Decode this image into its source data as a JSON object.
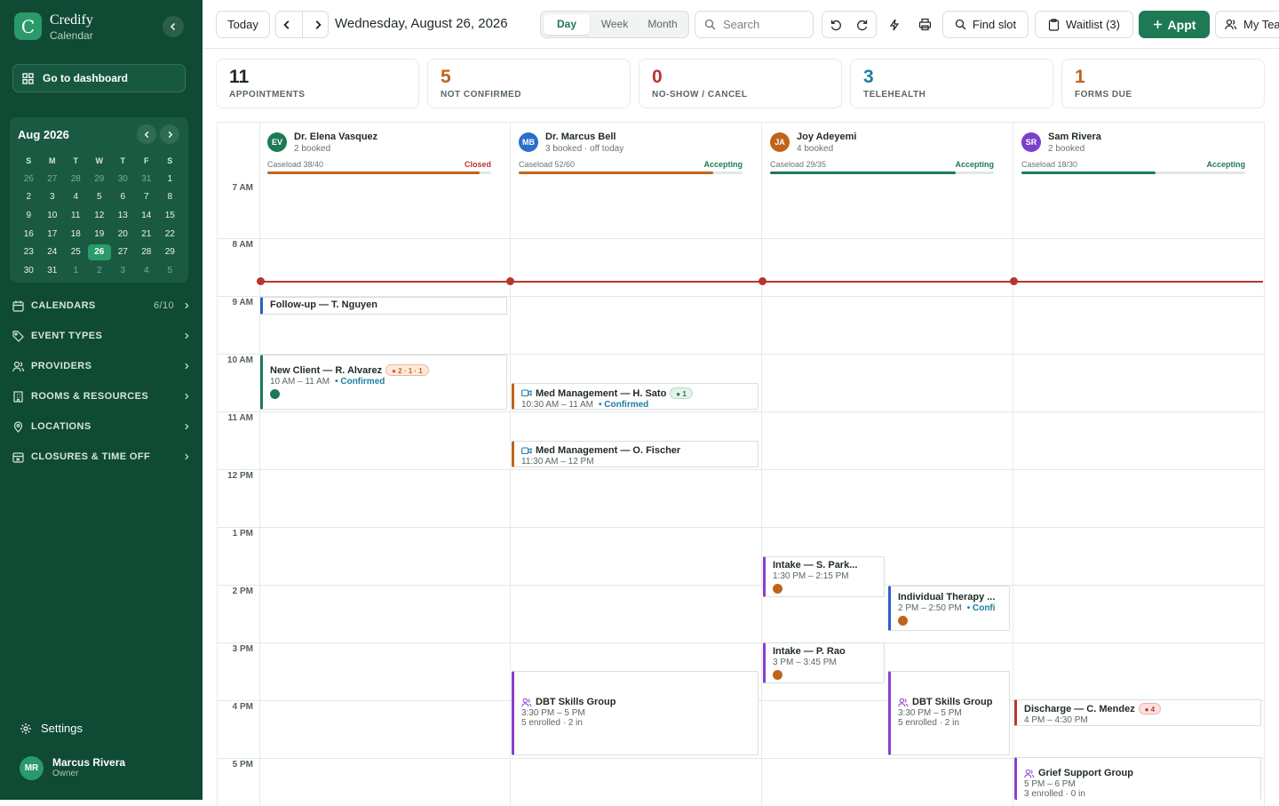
{
  "sidebar": {
    "logo_letter": "C",
    "brand": "Credify",
    "brand_sub": "Calendar",
    "dashboard_label": "Go to dashboard",
    "mini_cal": {
      "title": "Aug 2026",
      "weekdays": [
        "S",
        "M",
        "T",
        "W",
        "T",
        "F",
        "S"
      ],
      "weeks": [
        [
          "26",
          "27",
          "28",
          "29",
          "30",
          "31",
          "1"
        ],
        [
          "2",
          "3",
          "4",
          "5",
          "6",
          "7",
          "8"
        ],
        [
          "9",
          "10",
          "11",
          "12",
          "13",
          "14",
          "15"
        ],
        [
          "16",
          "17",
          "18",
          "19",
          "20",
          "21",
          "22"
        ],
        [
          "23",
          "24",
          "25",
          "26",
          "27",
          "28",
          "29"
        ],
        [
          "30",
          "31",
          "1",
          "2",
          "3",
          "4",
          "5"
        ]
      ],
      "selected": "26"
    },
    "nav": [
      {
        "label": "CALENDARS",
        "count": "6/10",
        "icon": "calendar-icon"
      },
      {
        "label": "EVENT TYPES",
        "count": "",
        "icon": "tag-icon"
      },
      {
        "label": "PROVIDERS",
        "count": "",
        "icon": "users-icon"
      },
      {
        "label": "ROOMS & RESOURCES",
        "count": "",
        "icon": "building-icon"
      },
      {
        "label": "LOCATIONS",
        "count": "",
        "icon": "pin-icon"
      },
      {
        "label": "CLOSURES & TIME OFF",
        "count": "",
        "icon": "calendar-x-icon"
      }
    ],
    "settings_label": "Settings",
    "user": {
      "initials": "MR",
      "name": "Marcus Rivera",
      "role": "Owner"
    }
  },
  "toolbar": {
    "today": "Today",
    "date": "Wednesday, August 26, 2026",
    "views": [
      "Day",
      "Week",
      "Month"
    ],
    "active_view": "Day",
    "search_placeholder": "Search",
    "find_slot": "Find slot",
    "waitlist": "Waitlist (3)",
    "new_appt": "Appt",
    "team": "My Tea"
  },
  "stats": [
    {
      "value": "11",
      "label": "APPOINTMENTS",
      "color": "#1f2a24"
    },
    {
      "value": "5",
      "label": "NOT CONFIRMED",
      "color": "#c0641c"
    },
    {
      "value": "0",
      "label": "NO-SHOW / CANCEL",
      "color": "#b5362f"
    },
    {
      "value": "3",
      "label": "TELEHEALTH",
      "color": "#1d7fa0"
    },
    {
      "value": "1",
      "label": "FORMS DUE",
      "color": "#c0641c"
    }
  ],
  "hours": [
    "7 AM",
    "8 AM",
    "9 AM",
    "10 AM",
    "11 AM",
    "12 PM",
    "1 PM",
    "2 PM",
    "3 PM",
    "4 PM",
    "5 PM"
  ],
  "providers": [
    {
      "initials": "EV",
      "name": "Dr. Elena Vasquez",
      "booked": "2 booked",
      "caseload": "Caseload 38/40",
      "status": "Closed",
      "status_color": "#b5362f",
      "avatar_color": "#1e7a55",
      "load": 0.95,
      "bar_color": "#c0641c"
    },
    {
      "initials": "MB",
      "name": "Dr. Marcus Bell",
      "booked": "3 booked · off today",
      "caseload": "Caseload 52/60",
      "status": "Accepting",
      "status_color": "#1e7a55",
      "avatar_color": "#2a6fc9",
      "load": 0.87,
      "bar_color": "#c0641c"
    },
    {
      "initials": "JA",
      "name": "Joy Adeyemi",
      "booked": "4 booked",
      "caseload": "Caseload 29/35",
      "status": "Accepting",
      "status_color": "#1e7a55",
      "avatar_color": "#c0641c",
      "load": 0.83,
      "bar_color": "#1e7a55"
    },
    {
      "initials": "SR",
      "name": "Sam Rivera",
      "booked": "2 booked",
      "caseload": "Caseload 18/30",
      "status": "Accepting",
      "status_color": "#1e7a55",
      "avatar_color": "#7b3fc9",
      "load": 0.6,
      "bar_color": "#1e7a55"
    }
  ],
  "events": {
    "e1": {
      "title": "Follow-up — T. Nguyen"
    },
    "e2": {
      "title": "New Client — R. Alvarez",
      "time": "10 AM – 11 AM",
      "status": "Confirmed",
      "chip": "2 · 1 · 1"
    },
    "e3": {
      "title": "Med Management — H. Sato",
      "time": "10:30 AM – 11 AM",
      "status": "Confirmed",
      "chip": "1"
    },
    "e4": {
      "title": "Med Management — O. Fischer",
      "time": "11:30 AM – 12 PM"
    },
    "e5": {
      "title": "Intake — S. Park...",
      "time": "1:30 PM – 2:15 PM"
    },
    "e6": {
      "title": "Individual Therapy ...",
      "time": "2 PM – 2:50 PM",
      "status": "Confi"
    },
    "e7": {
      "title": "Intake — P. Rao",
      "time": "3 PM – 3:45 PM"
    },
    "e8": {
      "title": "DBT Skills Group",
      "time": "3:30 PM – 5 PM",
      "detail": "5 enrolled · 2 in"
    },
    "e9": {
      "title": "DBT Skills Group",
      "time": "3:30 PM – 5 PM",
      "detail": "5 enrolled · 2 in"
    },
    "e10": {
      "title": "Discharge — C. Mendez",
      "time": "4 PM – 4:30 PM",
      "chip": "4"
    },
    "e11": {
      "title": "Grief Support Group",
      "time": "5 PM – 6 PM",
      "detail": "3 enrolled · 0 in"
    }
  }
}
